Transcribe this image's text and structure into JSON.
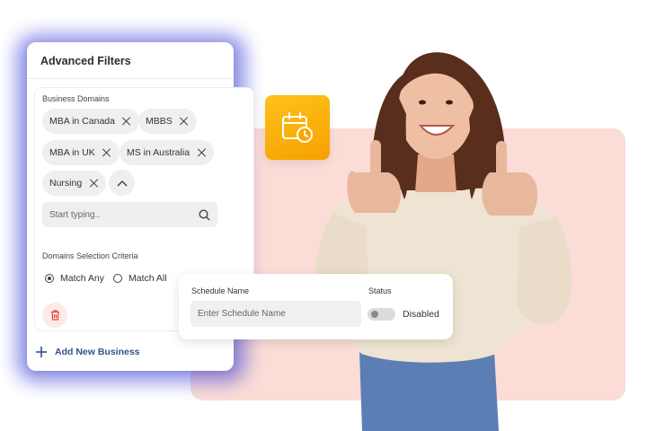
{
  "filters_panel": {
    "title": "Advanced Filters",
    "business_domains_label": "Business Domains",
    "chips": [
      "MBA in Canada",
      "MBBS",
      "MBA in UK",
      "MS in Australia",
      "Nursing"
    ],
    "search_placeholder": "Start typing..",
    "criteria_label": "Domains Selection Criteria",
    "options": [
      "Match Any",
      "Match All"
    ],
    "selected_option": "Match Any",
    "add_label": "Add New Business"
  },
  "schedule_card": {
    "name_label": "Schedule Name",
    "name_placeholder": "Enter Schedule Name",
    "status_label": "Status",
    "status_value": "Disabled"
  },
  "icons": [
    "calendar-clock-icon",
    "close-icon",
    "chevron-up-icon",
    "search-icon",
    "trash-icon",
    "plus-icon"
  ],
  "colors": {
    "accent_yellow": "#f5a100",
    "pink_backdrop": "#fbdcd6",
    "link_blue": "#34518a",
    "danger": "#e0443a"
  }
}
